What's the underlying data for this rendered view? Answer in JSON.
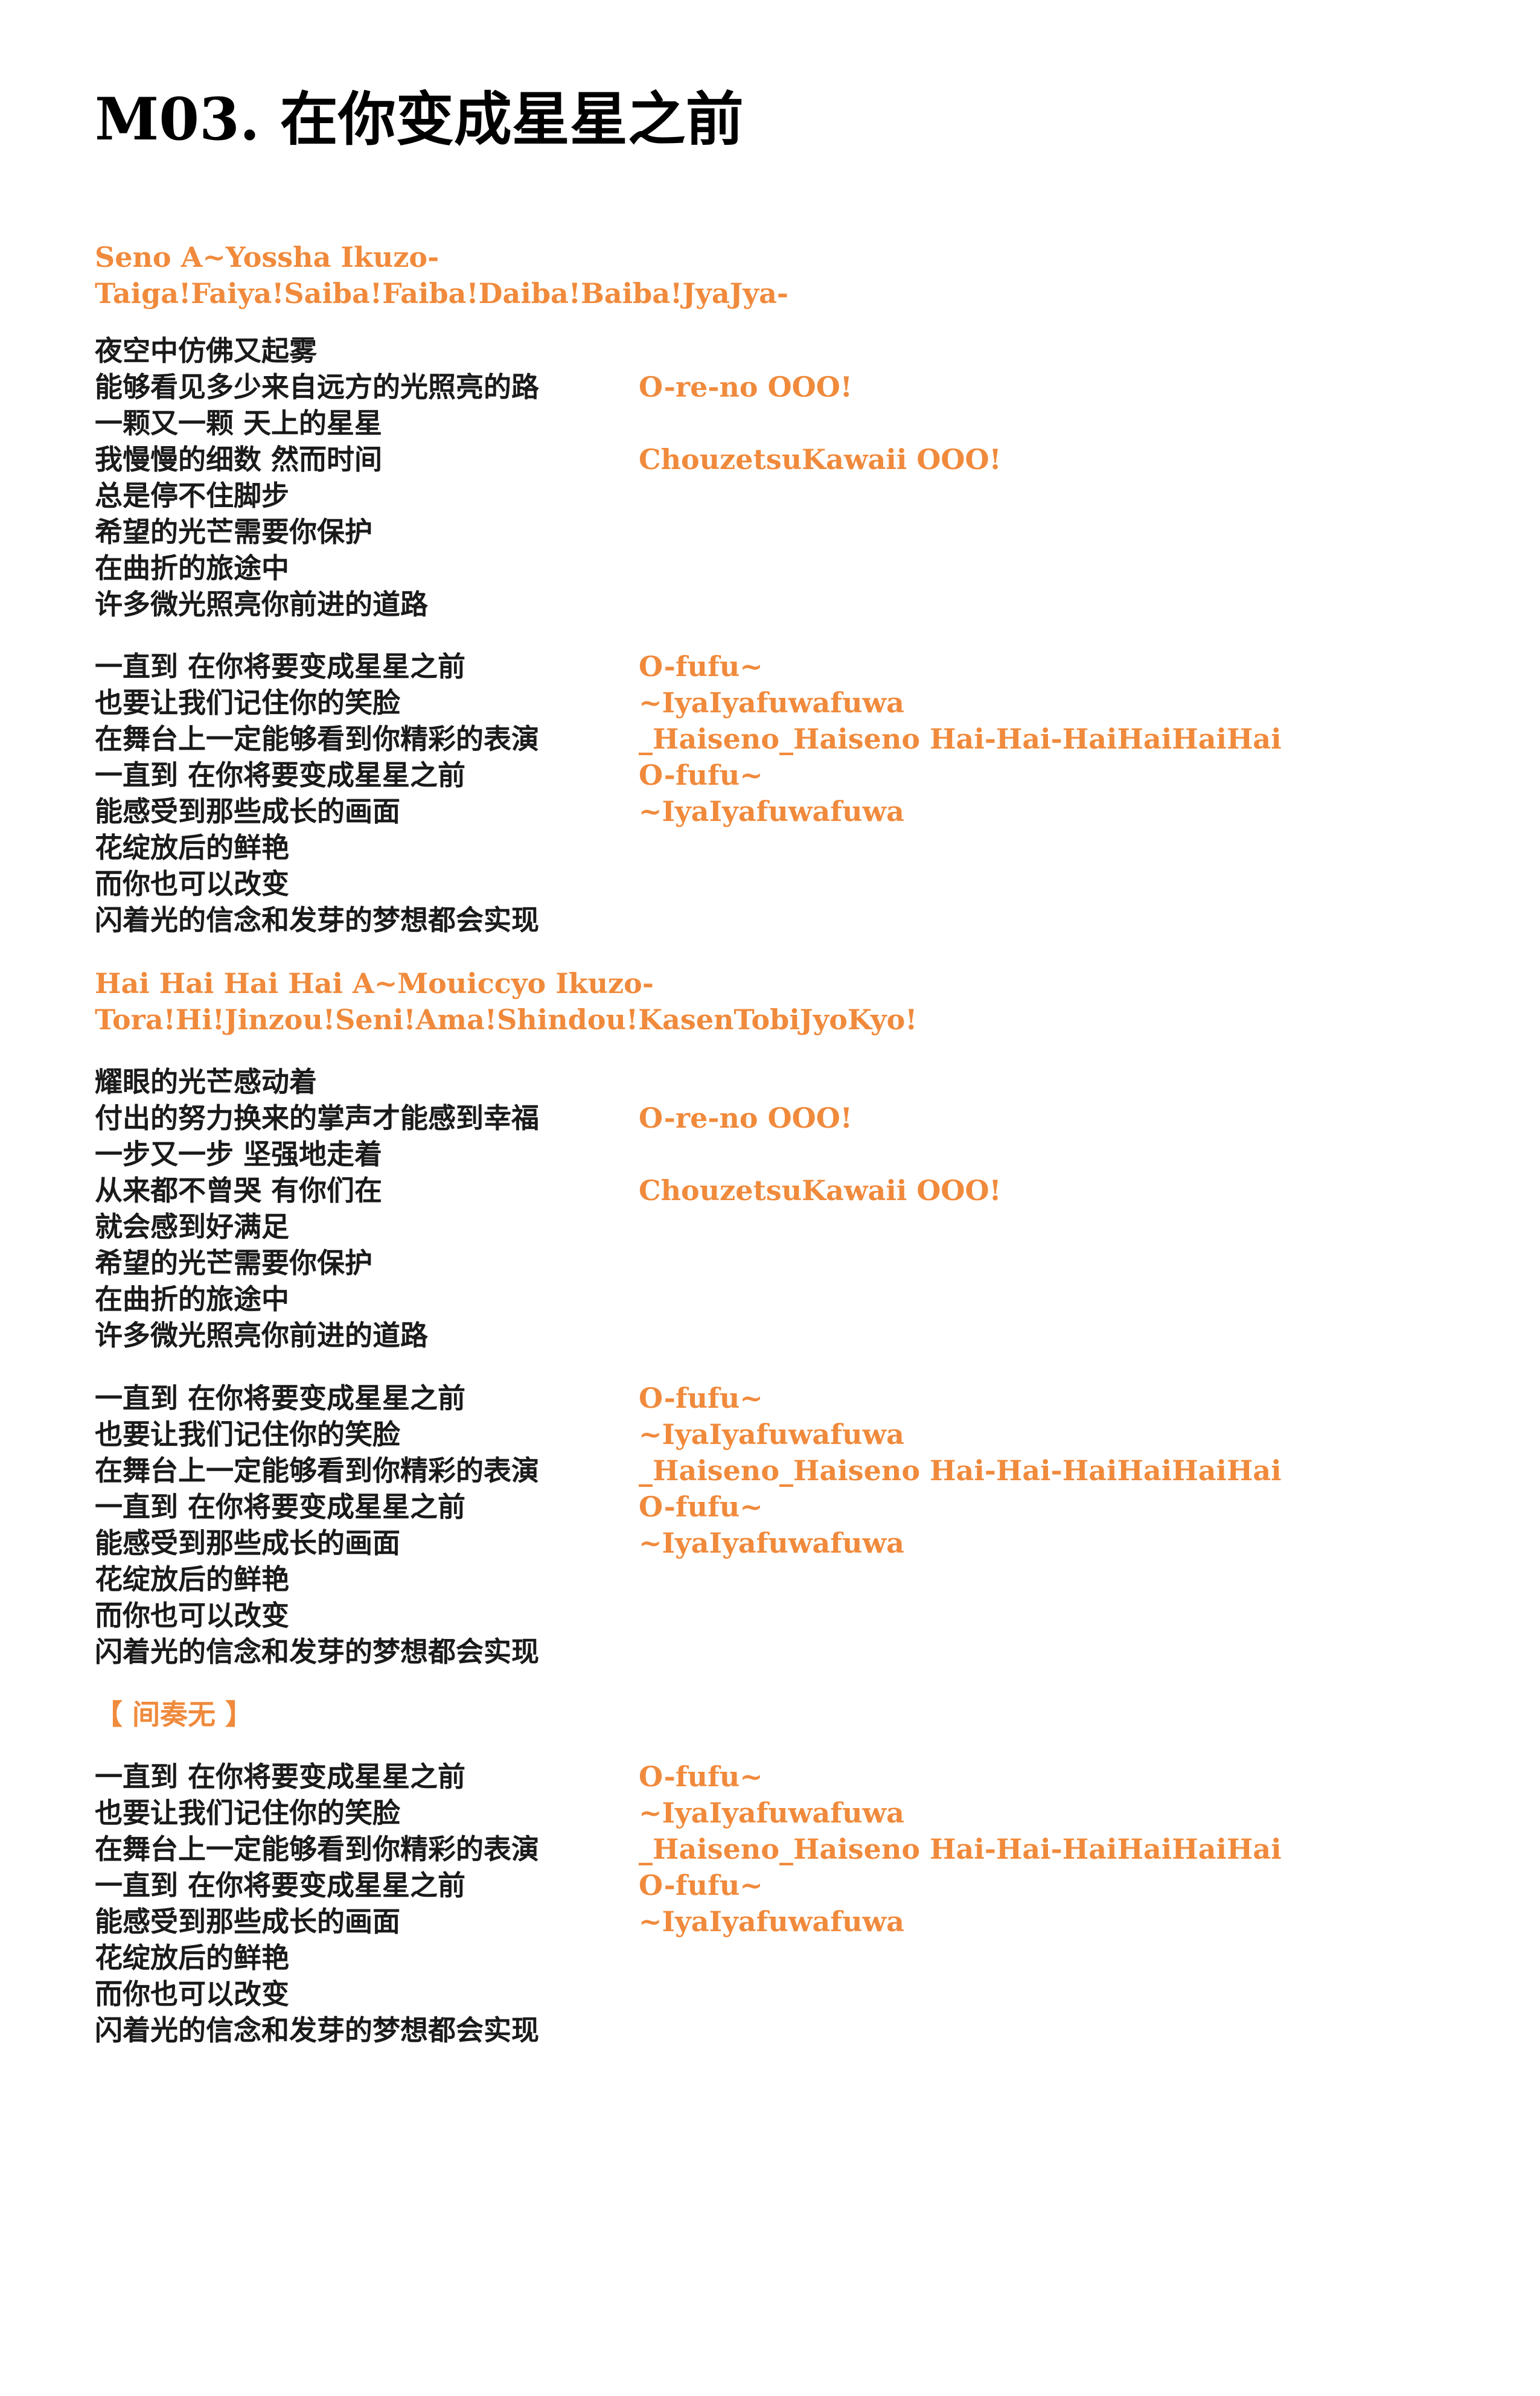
{
  "title": "M03. 在你变成星星之前",
  "intro1": [
    "Seno A~Yossha Ikuzo-",
    "Taiga!Faiya!Saiba!Faiba!Daiba!Baiba!JyaJya-"
  ],
  "verse1": [
    "夜空中仿佛又起雾",
    "能够看见多少来自远方的光照亮的路",
    "一颗又一颗 天上的星星",
    "我慢慢的细数 然而时间",
    "总是停不住脚步",
    "希望的光芒需要你保护",
    "在曲折的旅途中",
    "许多微光照亮你前进的道路"
  ],
  "verse_calls": [
    "O-re-no OOO!",
    "ChouzetsuKawaii OOO!"
  ],
  "chorus1": [
    "一直到 在你将要变成星星之前",
    "也要让我们记住你的笑脸",
    "在舞台上一定能够看到你精彩的表演",
    "一直到 在你将要变成星星之前",
    "能感受到那些成长的画面",
    "花绽放后的鲜艳",
    "而你也可以改变",
    "闪着光的信念和发芽的梦想都会实现"
  ],
  "chorus_calls": [
    "O-fufu~",
    "~IyaIyafuwafuwa",
    "_Haiseno_Haiseno Hai-Hai-HaiHaiHaiHai",
    "O-fufu~",
    "~IyaIyafuwafuwa"
  ],
  "intro2": [
    "Hai Hai Hai Hai  A~Mouiccyo Ikuzo-",
    "Tora!Hi!Jinzou!Seni!Ama!Shindou!KasenTobiJyoKyo!"
  ],
  "verse2": [
    "耀眼的光芒感动着",
    "付出的努力换来的掌声才能感到幸福",
    "一步又一步 坚强地走着",
    "从来都不曾哭 有你们在",
    "就会感到好满足",
    "希望的光芒需要你保护",
    "在曲折的旅途中",
    "许多微光照亮你前进的道路"
  ],
  "chorus2": [
    "一直到 在你将要变成星星之前",
    "也要让我们记住你的笑脸",
    "在舞台上一定能够看到你精彩的表演",
    "一直到 在你将要变成星星之前",
    "能感受到那些成长的画面",
    "花绽放后的鲜艳",
    "而你也可以改变",
    "闪着光的信念和发芽的梦想都会实现"
  ],
  "interlude": "【 间奏无 】",
  "chorus3": [
    "一直到 在你将要变成星星之前",
    "也要让我们记住你的笑脸",
    "在舞台上一定能够看到你精彩的表演",
    "一直到 在你将要变成星星之前",
    "能感受到那些成长的画面",
    "花绽放后的鲜艳",
    "而你也可以改变",
    "闪着光的信念和发芽的梦想都会实现"
  ],
  "colors": {
    "lyric": "#1a1a1a",
    "call": "#f08a3c"
  }
}
